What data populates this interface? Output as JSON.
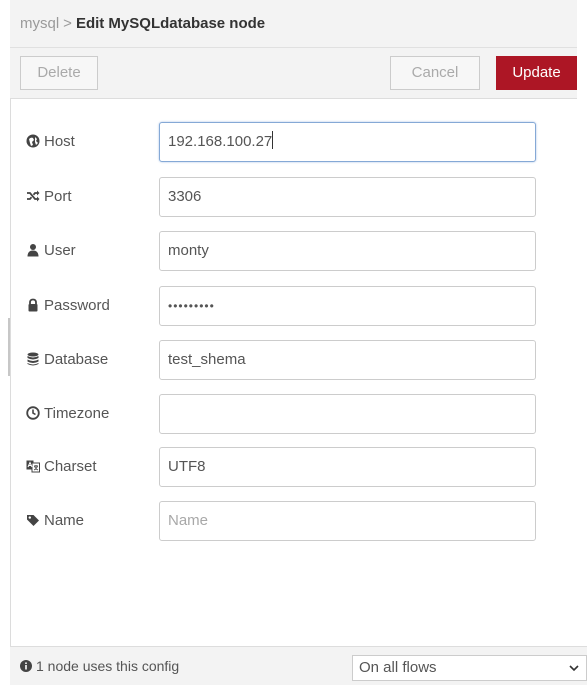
{
  "breadcrumb": {
    "parent": "mysql",
    "separator": ">",
    "current": "Edit MySQLdatabase node"
  },
  "toolbar": {
    "delete_label": "Delete",
    "cancel_label": "Cancel",
    "update_label": "Update"
  },
  "fields": [
    {
      "key": "host",
      "label": "Host",
      "icon": "globe-icon",
      "value": "192.168.100.27",
      "focused": true
    },
    {
      "key": "port",
      "label": "Port",
      "icon": "random-icon",
      "value": "3306"
    },
    {
      "key": "user",
      "label": "User",
      "icon": "user-icon",
      "value": "monty"
    },
    {
      "key": "password",
      "label": "Password",
      "icon": "lock-icon",
      "value": "•••••••••"
    },
    {
      "key": "database",
      "label": "Database",
      "icon": "database-icon",
      "value": "test_shema"
    },
    {
      "key": "timezone",
      "label": "Timezone",
      "icon": "clock-icon",
      "value": ""
    },
    {
      "key": "charset",
      "label": "Charset",
      "icon": "language-icon",
      "value": "UTF8"
    },
    {
      "key": "name",
      "label": "Name",
      "icon": "tag-icon",
      "value": "",
      "placeholder": "Name"
    }
  ],
  "footer": {
    "info": "1 node uses this config",
    "scope_value": "On all flows"
  },
  "colors": {
    "accent": "#ad1625",
    "panel": "#f3f3f3",
    "border": "#cccccc"
  }
}
